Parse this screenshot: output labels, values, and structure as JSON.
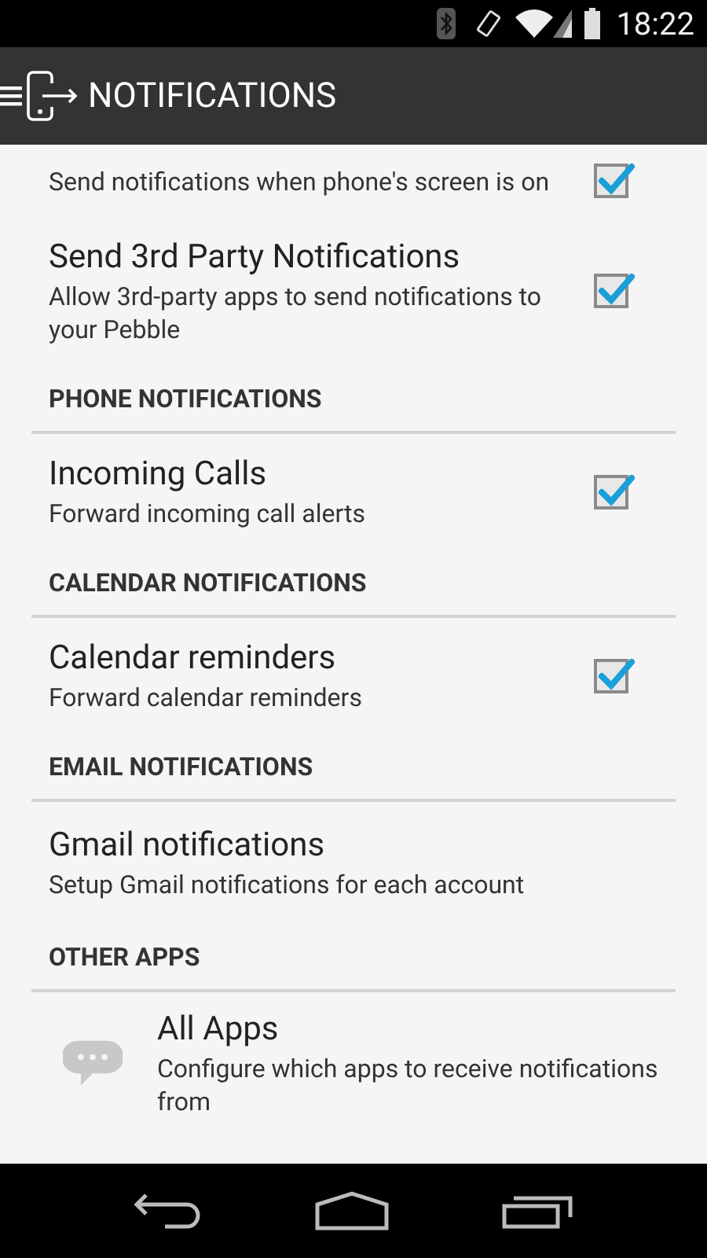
{
  "status_bar": {
    "time": "18:22"
  },
  "action_bar": {
    "title": "NOTIFICATIONS"
  },
  "sections": [
    {
      "items": [
        {
          "kind": "checkbox",
          "summary": "Send notifications when phone's screen is on",
          "checked": true
        },
        {
          "kind": "checkbox",
          "title": "Send 3rd Party Notifications",
          "summary": "Allow 3rd-party apps to send notifications to your Pebble",
          "checked": true
        }
      ]
    },
    {
      "header": "PHONE NOTIFICATIONS",
      "items": [
        {
          "kind": "checkbox",
          "title": "Incoming Calls",
          "summary": "Forward incoming call alerts",
          "checked": true
        }
      ]
    },
    {
      "header": "CALENDAR NOTIFICATIONS",
      "items": [
        {
          "kind": "checkbox",
          "title": "Calendar reminders",
          "summary": "Forward calendar reminders",
          "checked": true
        }
      ]
    },
    {
      "header": "EMAIL NOTIFICATIONS",
      "items": [
        {
          "kind": "plain",
          "title": "Gmail notifications",
          "summary": "Setup Gmail notifications for each account"
        }
      ]
    },
    {
      "header": "OTHER APPS",
      "items": [
        {
          "kind": "icon",
          "title": "All Apps",
          "summary": "Configure which apps to receive notifications from"
        }
      ]
    }
  ]
}
